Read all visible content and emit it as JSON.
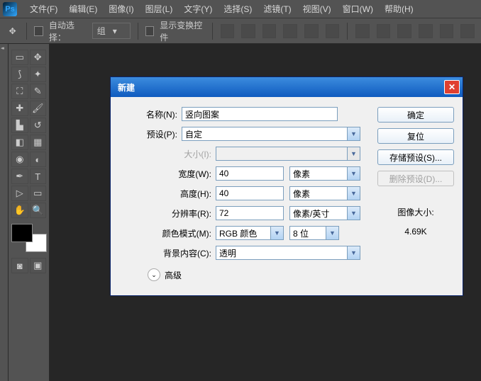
{
  "menu": {
    "items": [
      "文件(F)",
      "编辑(E)",
      "图像(I)",
      "图层(L)",
      "文字(Y)",
      "选择(S)",
      "滤镜(T)",
      "视图(V)",
      "窗口(W)",
      "帮助(H)"
    ]
  },
  "optbar": {
    "auto_select": "自动选择：",
    "group": "组",
    "show_transform": "显示变换控件"
  },
  "dialog": {
    "title": "新建",
    "labels": {
      "name": "名称(N):",
      "preset": "预设(P):",
      "size": "大小(I):",
      "width": "宽度(W):",
      "height": "高度(H):",
      "resolution": "分辨率(R):",
      "color_mode": "颜色模式(M):",
      "bg": "背景内容(C):",
      "advanced": "高级"
    },
    "values": {
      "name": "竖向图案",
      "preset": "自定",
      "width": "40",
      "width_unit": "像素",
      "height": "40",
      "height_unit": "像素",
      "resolution": "72",
      "resolution_unit": "像素/英寸",
      "color_mode": "RGB 颜色",
      "depth": "8 位",
      "bg": "透明"
    },
    "buttons": {
      "ok": "确定",
      "reset": "复位",
      "save_preset": "存储预设(S)...",
      "delete_preset": "删除预设(D)..."
    },
    "info": {
      "label": "图像大小:",
      "value": "4.69K"
    }
  }
}
